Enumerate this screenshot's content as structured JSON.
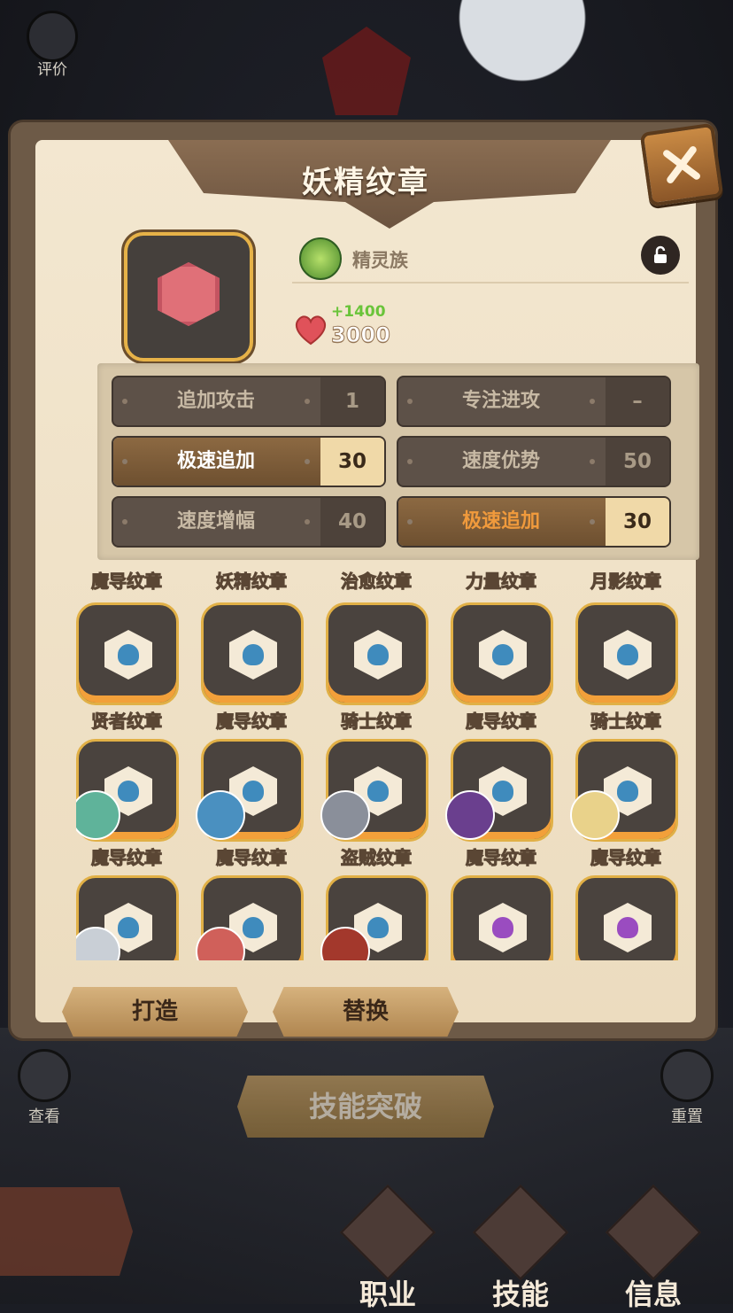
{
  "top": {
    "rate_label": "评价"
  },
  "modal": {
    "title": "妖精纹章",
    "race": "精灵族",
    "power_bonus": "+1400",
    "power": "3000",
    "attributes": [
      {
        "name": "追加攻击",
        "value": "1"
      },
      {
        "name": "专注进攻",
        "value": "–"
      },
      {
        "name": "极速追加",
        "value": "30"
      },
      {
        "name": "速度优势",
        "value": "50"
      },
      {
        "name": "速度增幅",
        "value": "40"
      },
      {
        "name": "极速追加",
        "value": "30"
      }
    ],
    "grid_top_labels": [
      "魔导纹章",
      "妖精纹章",
      "治愈纹章",
      "力量纹章",
      "月影纹章"
    ],
    "grid_rows": [
      [
        "贤者纹章",
        "魔导纹章",
        "骑士纹章",
        "魔导纹章",
        "骑士纹章"
      ],
      [
        "魔导纹章",
        "魔导纹章",
        "盗贼纹章",
        "魔导纹章",
        "魔导纹章"
      ]
    ],
    "buttons": {
      "forge": "打造",
      "replace": "替换"
    }
  },
  "bottom": {
    "view_label": "查看",
    "reset_label": "重置",
    "skill_break": "技能突破",
    "nav": [
      "职业",
      "技能",
      "信息"
    ]
  },
  "colors": {
    "accent": "#e1b046",
    "paper": "#f3e7d0",
    "active_orange": "#f09a3c"
  }
}
